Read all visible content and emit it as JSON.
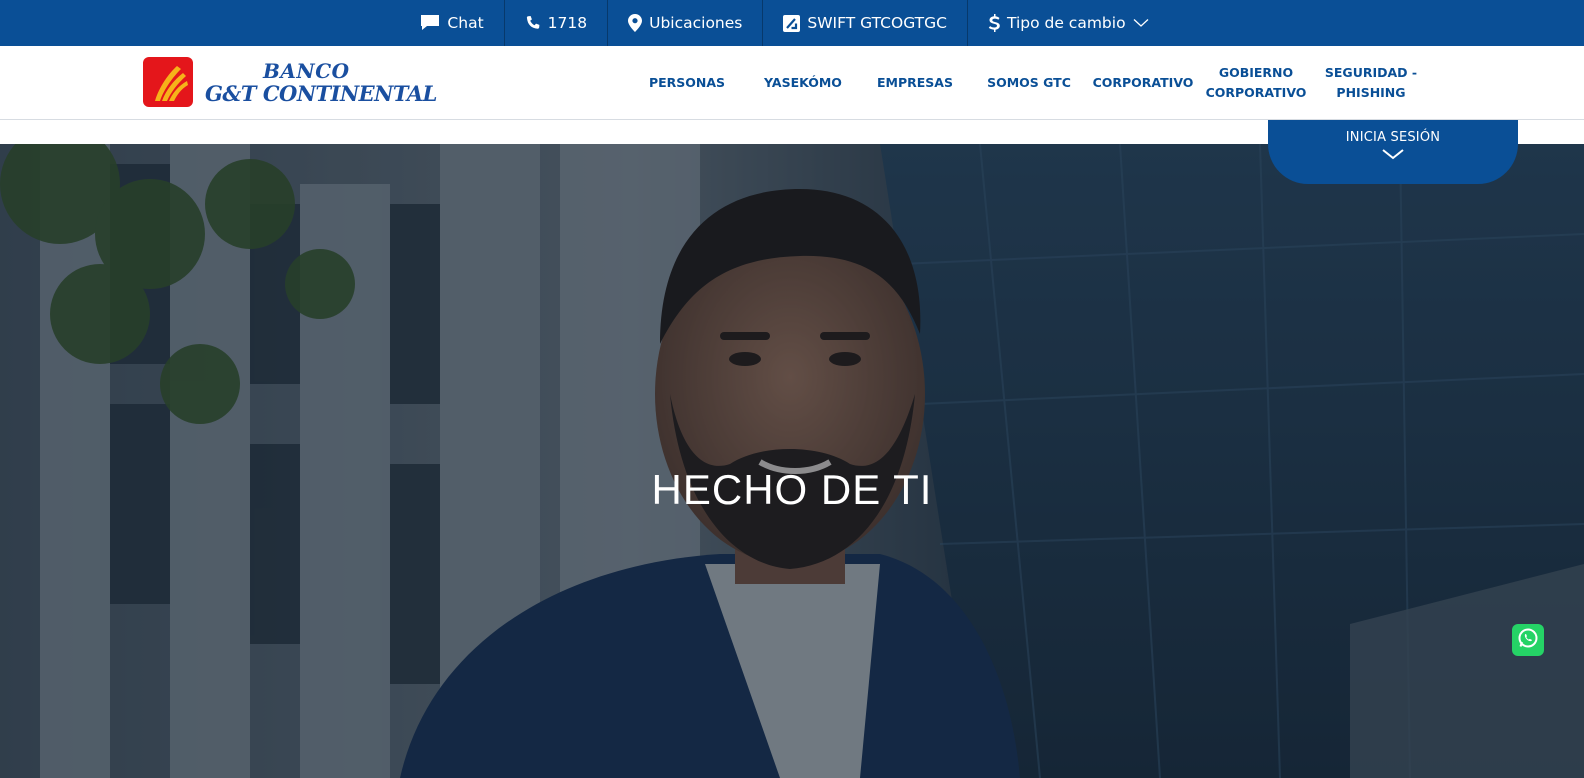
{
  "topbar": {
    "items": [
      {
        "label": "Chat",
        "icon": "chat-icon"
      },
      {
        "label": "1718",
        "icon": "phone-icon"
      },
      {
        "label": "Ubicaciones",
        "icon": "location-pin-icon"
      },
      {
        "label": "SWIFT GTCOGTGC",
        "icon": "swift-icon"
      },
      {
        "label": "Tipo de cambio",
        "icon": "dollar-icon"
      }
    ]
  },
  "brand": {
    "line1": "BANCO",
    "line2": "G&T CONTINENTAL",
    "logo_red": "#e4161b",
    "logo_blue": "#1a4fa0"
  },
  "nav": {
    "items": [
      {
        "line1": "PERSONAS",
        "line2": ""
      },
      {
        "line1": "YASEKÓMO",
        "line2": ""
      },
      {
        "line1": "EMPRESAS",
        "line2": ""
      },
      {
        "line1": "SOMOS GTC",
        "line2": ""
      },
      {
        "line1": "CORPORATIVO",
        "line2": ""
      },
      {
        "line1": "GOBIERNO",
        "line2": "CORPORATIVO"
      },
      {
        "line1": "SEGURIDAD -",
        "line2": "PHISHING"
      }
    ]
  },
  "login": {
    "label": "INICIA SESIÓN"
  },
  "hero": {
    "title": "HECHO DE TI"
  },
  "colors": {
    "primary": "#0a4f96",
    "whatsapp": "#25d366"
  },
  "whatsapp": {
    "icon": "whatsapp-icon"
  }
}
